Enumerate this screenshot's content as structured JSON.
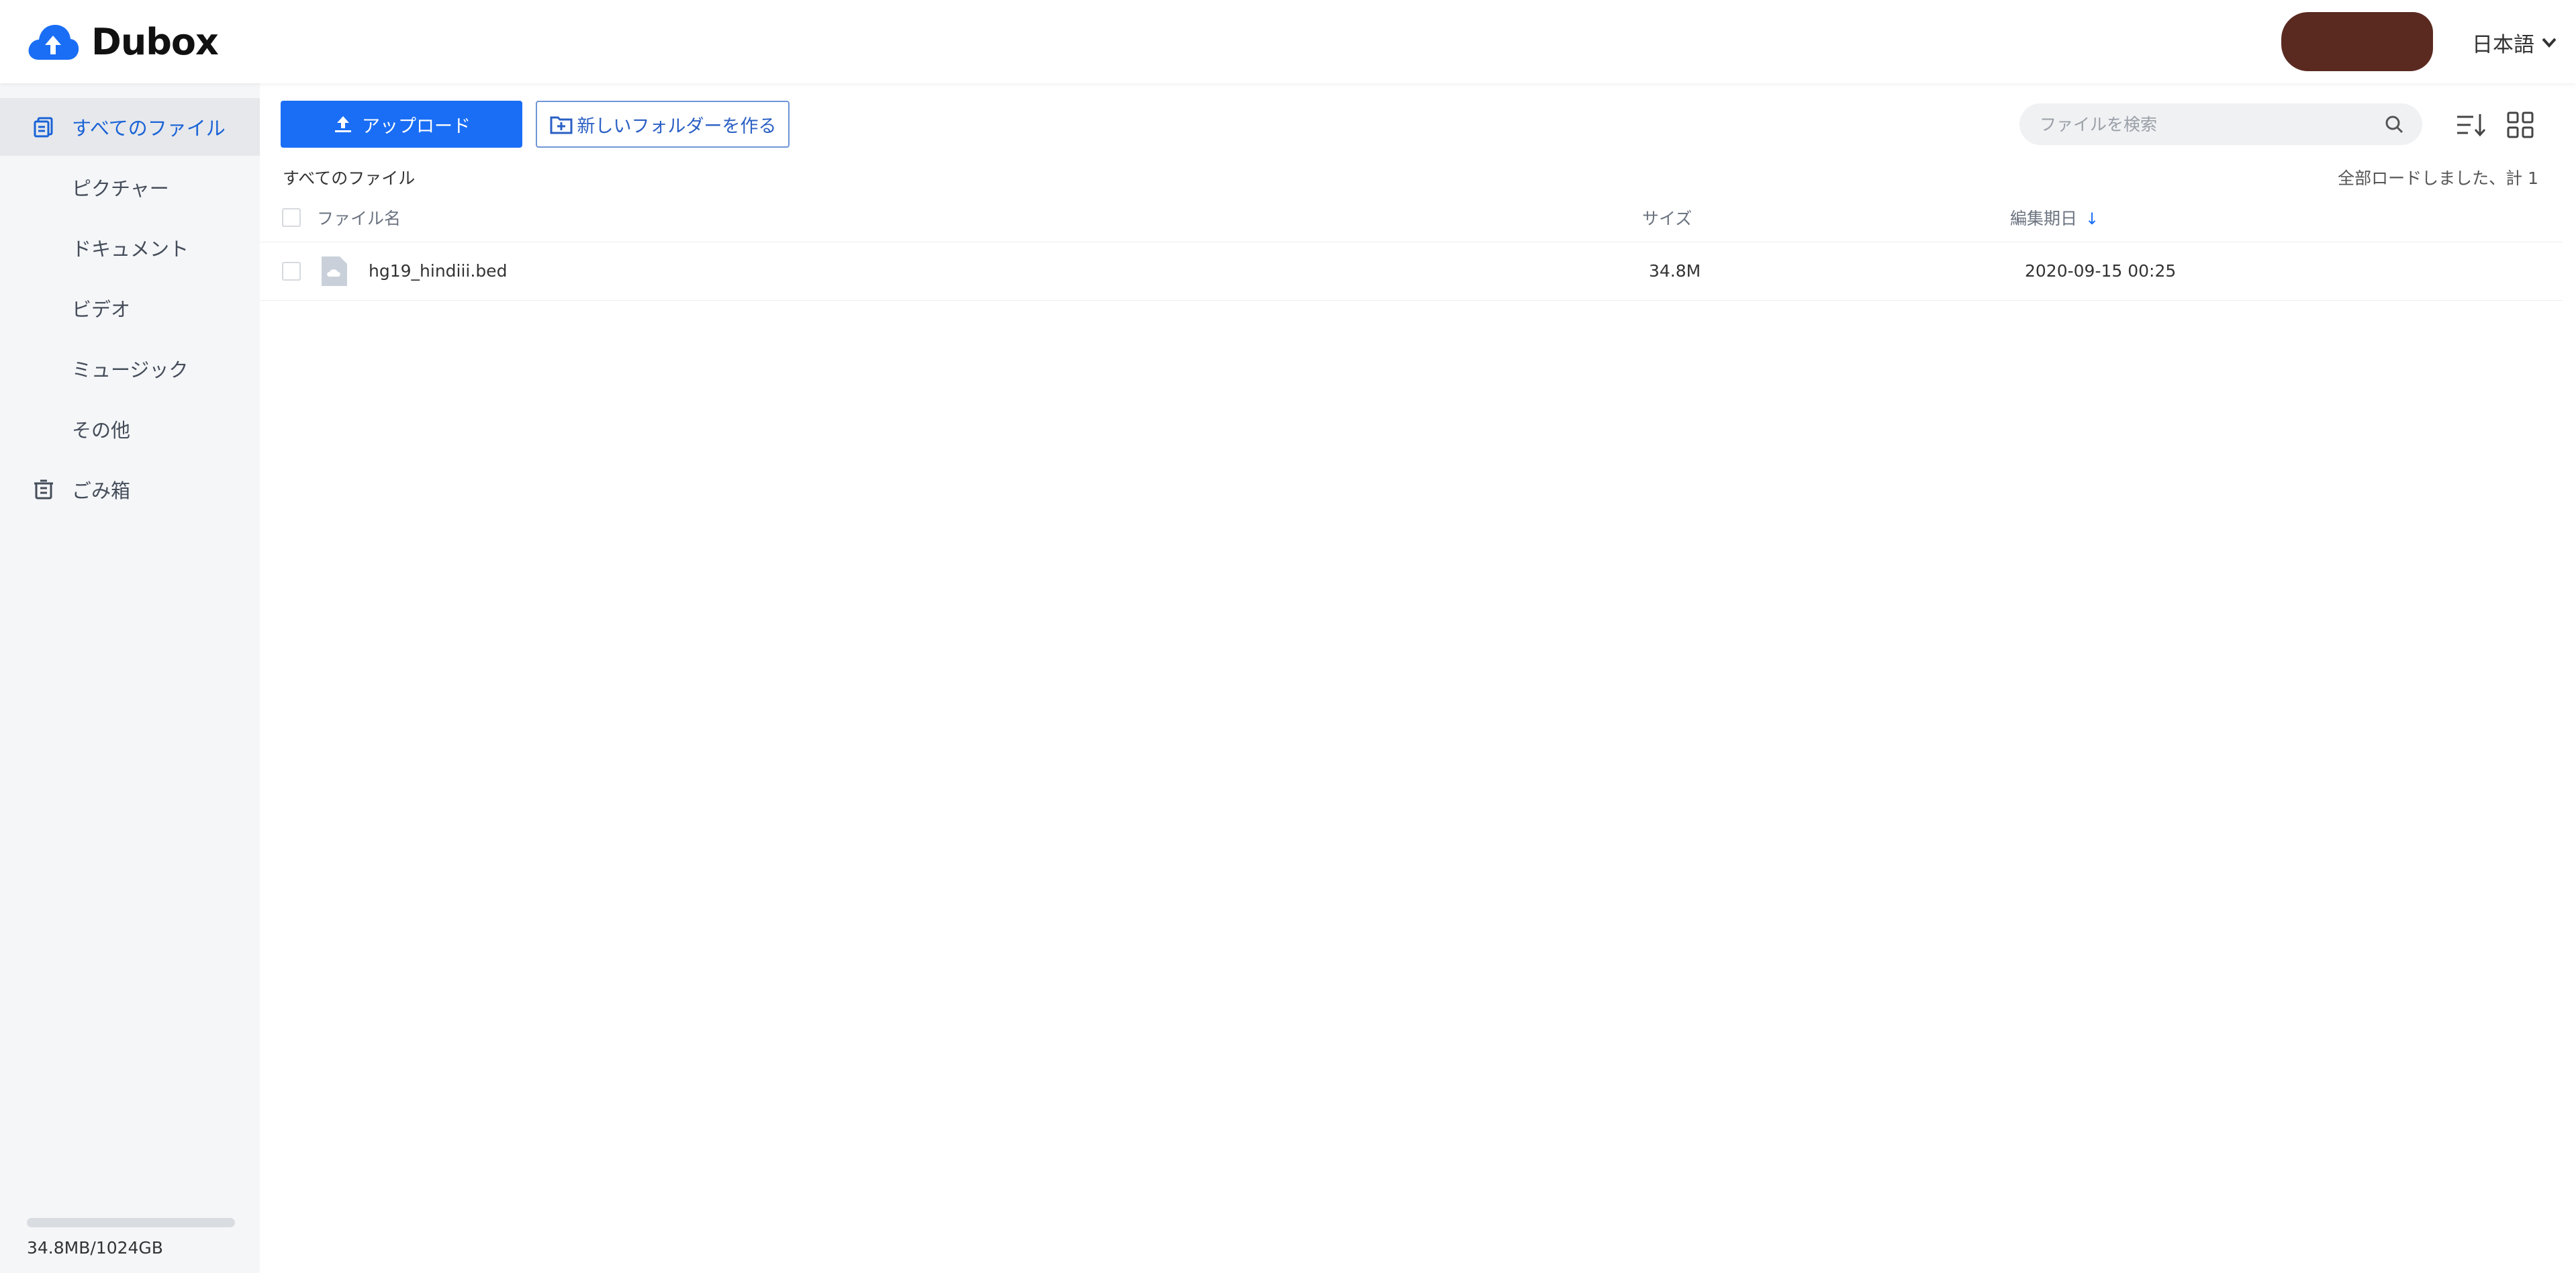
{
  "app": {
    "name": "Dubox"
  },
  "header": {
    "language": "日本語"
  },
  "sidebar": {
    "items": [
      {
        "label": "すべてのファイル",
        "active": true
      },
      {
        "label": "ピクチャー"
      },
      {
        "label": "ドキュメント"
      },
      {
        "label": "ビデオ"
      },
      {
        "label": "ミュージック"
      },
      {
        "label": "その他"
      },
      {
        "label": "ごみ箱"
      }
    ],
    "storage": {
      "used_fraction": 3e-05,
      "text": "34.8MB/1024GB"
    }
  },
  "toolbar": {
    "upload_label": "アップロード",
    "new_folder_label": "新しいフォルダーを作る",
    "search_placeholder": "ファイルを検索"
  },
  "breadcrumb": "すべてのファイル",
  "status": "全部ロードしました、計 1",
  "table": {
    "columns": {
      "name": "ファイル名",
      "size": "サイズ",
      "modified": "編集期日"
    },
    "rows": [
      {
        "name": "hg19_hindiii.bed",
        "size": "34.8M",
        "modified": "2020-09-15 00:25"
      }
    ]
  },
  "colors": {
    "accent": "#1a6ef5",
    "sidebar_bg": "#f5f6f8",
    "active_text": "#1a63d6"
  },
  "icons": [
    "cloud-upload-logo-icon",
    "chevron-down-icon",
    "all-files-icon",
    "trash-icon",
    "upload-icon",
    "new-folder-icon",
    "search-icon",
    "sort-list-icon",
    "grid-view-icon",
    "file-cloud-icon",
    "sort-down-arrow-icon"
  ]
}
